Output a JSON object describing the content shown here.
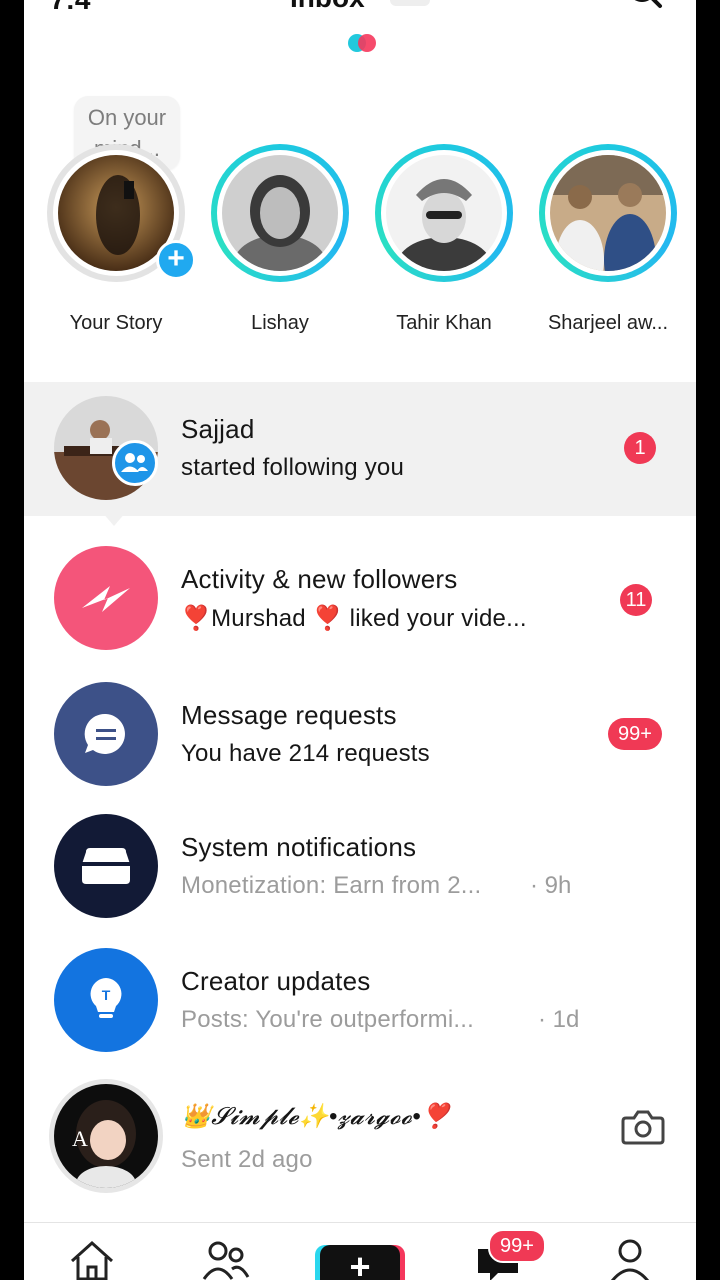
{
  "status": {
    "time": "7:4"
  },
  "header": {
    "title": "Inbox"
  },
  "stories": {
    "bubble_text": "On your mind...",
    "items": [
      {
        "name": "Your Story"
      },
      {
        "name": "Lishay"
      },
      {
        "name": "Tahir Khan"
      },
      {
        "name": "Sharjeel aw..."
      }
    ]
  },
  "rows": [
    {
      "title": "Sajjad",
      "subtitle": "started following you",
      "badge": "1"
    },
    {
      "title": "Activity & new followers",
      "subtitle": "❣️Murshad ❣️ liked your vide...",
      "badge": "11"
    },
    {
      "title": "Message requests",
      "subtitle": "You have 214 requests",
      "badge": "99+"
    },
    {
      "title": "System notifications",
      "subtitle": "Monetization: Earn from 2...",
      "time": "· 9h"
    },
    {
      "title": "Creator updates",
      "subtitle": "Posts: You're outperformi...",
      "time": "· 1d"
    },
    {
      "title": "👑𝓢𝓲𝓶𝓹𝓵𝓮✨•𝔃𝓪𝓻𝓰𝓸𝓸•❣️",
      "subtitle": "Sent 2d ago"
    }
  ],
  "nav": {
    "inbox_badge": "99+"
  },
  "colors": {
    "accent_red": "#f03955",
    "accent_blue": "#1f95e8",
    "ring_cyan": "#1ec9e0"
  }
}
